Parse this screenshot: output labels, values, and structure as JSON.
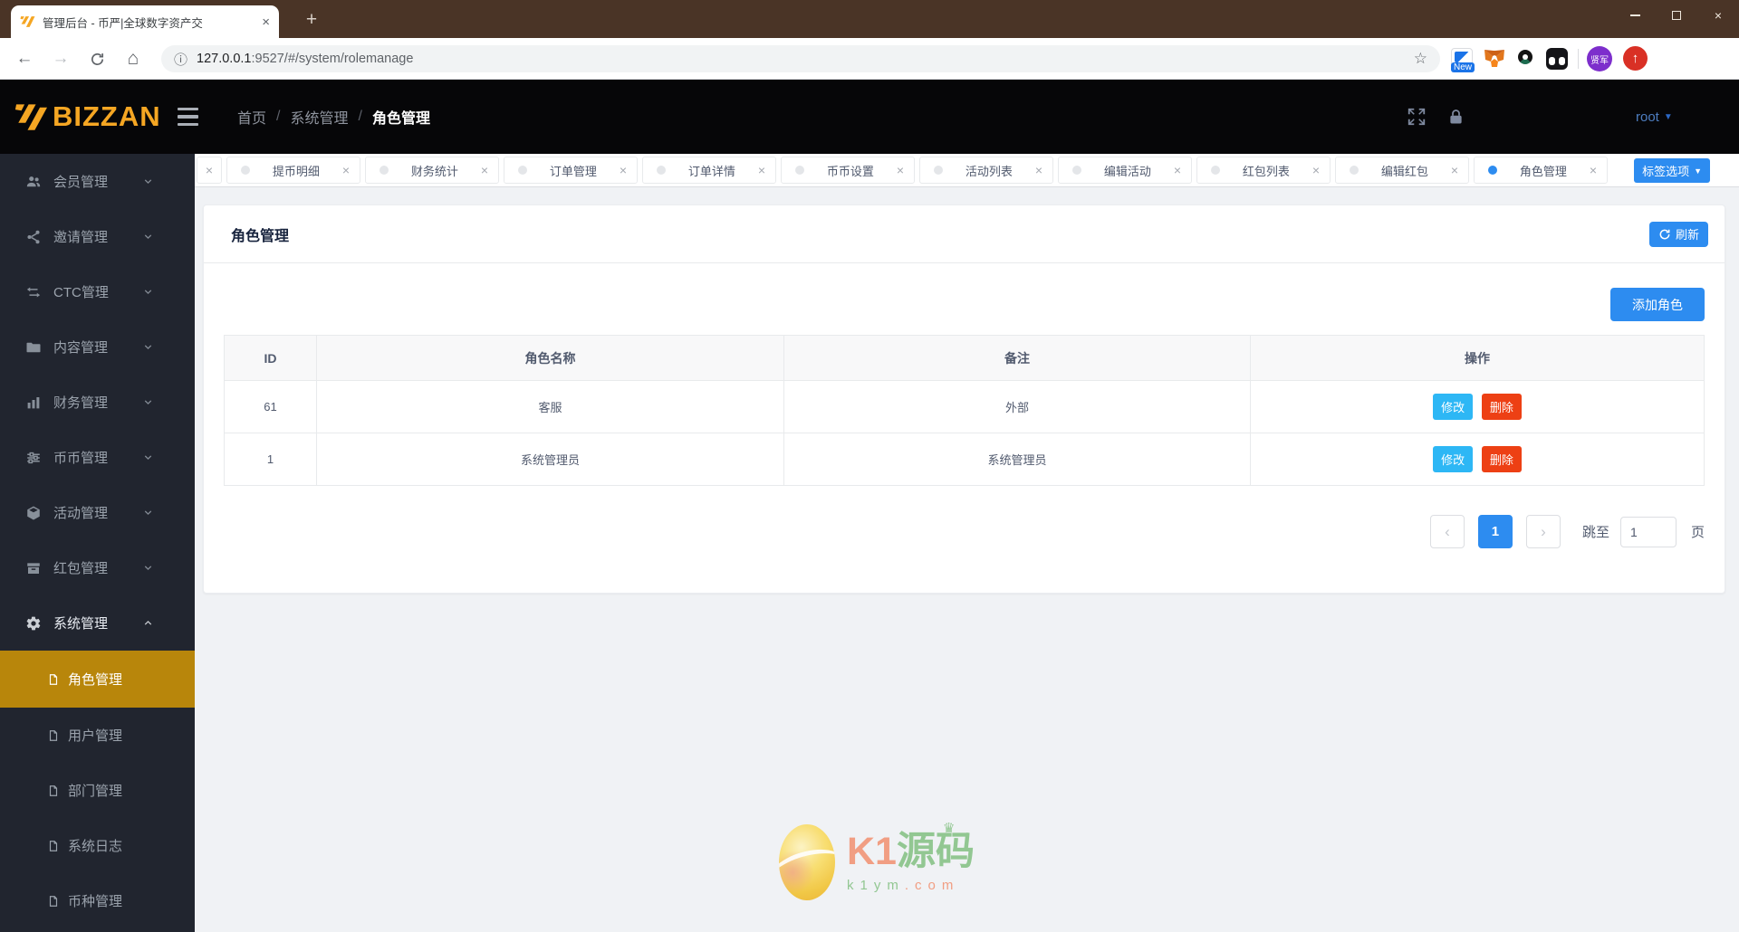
{
  "colors": {
    "primary": "#2d8cf0",
    "info": "#2db7f5",
    "danger": "#ed4014",
    "sidebar_active": "#b8860b",
    "logo_gold": "#f5a623",
    "avatar_orange": "#e8721c"
  },
  "browser": {
    "tab_title": "管理后台 - 币严|全球数字资产交",
    "url_host": "127.0.0.1",
    "url_rest": ":9527/#/system/rolemanage",
    "extension_badge": "New",
    "profile_initials": "贤军"
  },
  "icons": {
    "close": "×",
    "new_tab": "+",
    "back": "←",
    "forward": "→",
    "home": "⌂",
    "info": "ⓘ",
    "star": "☆",
    "caret_down": "▼",
    "prev": "‹",
    "next": "›",
    "sep": "/",
    "update_arrow": "↑",
    "crown": "♛"
  },
  "header": {
    "logo_text": "BIZZAN",
    "breadcrumb": [
      "首页",
      "系统管理",
      "角色管理"
    ],
    "username": "root"
  },
  "tabbar": {
    "tabs": [
      "提币明细",
      "财务统计",
      "订单管理",
      "订单详情",
      "币币设置",
      "活动列表",
      "编辑活动",
      "红包列表",
      "编辑红包",
      "角色管理"
    ],
    "options_button": "标签选项"
  },
  "sidebar": {
    "items": [
      {
        "label": "会员管理",
        "icon": "users-icon"
      },
      {
        "label": "邀请管理",
        "icon": "share-icon"
      },
      {
        "label": "CTC管理",
        "icon": "swap-icon"
      },
      {
        "label": "内容管理",
        "icon": "folder-icon"
      },
      {
        "label": "财务管理",
        "icon": "bar-chart-icon"
      },
      {
        "label": "币币管理",
        "icon": "sliders-icon"
      },
      {
        "label": "活动管理",
        "icon": "cube-icon"
      },
      {
        "label": "红包管理",
        "icon": "archive-icon"
      },
      {
        "label": "系统管理",
        "icon": "gear-icon"
      }
    ],
    "submenu": [
      {
        "label": "角色管理",
        "active": true
      },
      {
        "label": "用户管理"
      },
      {
        "label": "部门管理"
      },
      {
        "label": "系统日志"
      },
      {
        "label": "币种管理"
      }
    ]
  },
  "main": {
    "card_title": "角色管理",
    "refresh_label": "刷新",
    "add_role_label": "添加角色",
    "table": {
      "columns": [
        "ID",
        "角色名称",
        "备注",
        "操作"
      ],
      "rows": [
        {
          "id": "61",
          "name": "客服",
          "note": "外部"
        },
        {
          "id": "1",
          "name": "系统管理员",
          "note": "系统管理员"
        }
      ],
      "edit_label": "修改",
      "delete_label": "删除"
    },
    "pagination": {
      "current": "1",
      "jump_label": "跳至",
      "jump_value": "1",
      "unit_label": "页"
    }
  },
  "watermark": {
    "brand_left": "K1",
    "brand_right": "源码",
    "domain_green": "k1ym",
    "domain_orange": ".com"
  }
}
